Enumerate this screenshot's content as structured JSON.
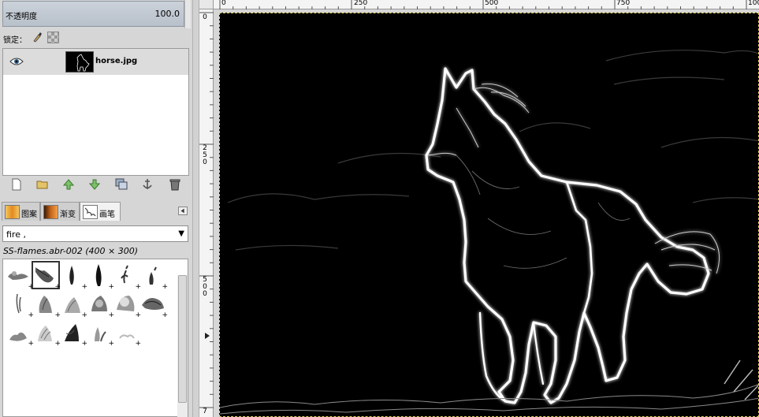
{
  "layers_panel": {
    "opacity_label": "不透明度",
    "opacity_value": "100.0",
    "lock_label": "锁定：",
    "layer": {
      "name": "horse.jpg",
      "visible": true
    }
  },
  "layer_tool_icons": [
    "new-layer-icon",
    "open-folder-icon",
    "raise-layer-icon",
    "lower-layer-icon",
    "duplicate-layer-icon",
    "anchor-layer-icon",
    "delete-layer-icon"
  ],
  "dock_tabs": [
    {
      "label": "图案",
      "active": false
    },
    {
      "label": "渐变",
      "active": false
    },
    {
      "label": "画笔",
      "active": true
    }
  ],
  "brushes_panel": {
    "filter_value": "fire ,",
    "selected_brush_info": "SS-flames.abr-002 (400 × 300)"
  },
  "ruler": {
    "top_labels": [
      "0",
      "250",
      "500",
      "750",
      "100"
    ],
    "left_labels": [
      "0",
      "2 5 0",
      "5 0 0",
      "7"
    ]
  },
  "colors": {
    "panel_bg": "#d6d6d6",
    "canvas_bg": "#000000",
    "selection_border": "#e0d45a",
    "glow_outline": "#ffffff"
  }
}
